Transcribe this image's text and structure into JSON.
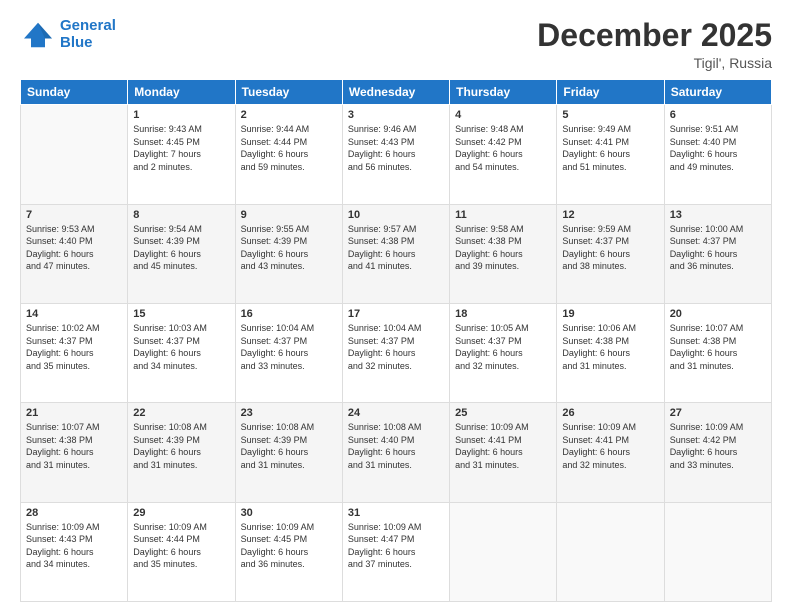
{
  "header": {
    "logo_line1": "General",
    "logo_line2": "Blue",
    "month": "December 2025",
    "location": "Tigil', Russia"
  },
  "weekdays": [
    "Sunday",
    "Monday",
    "Tuesday",
    "Wednesday",
    "Thursday",
    "Friday",
    "Saturday"
  ],
  "weeks": [
    [
      {
        "day": "",
        "info": ""
      },
      {
        "day": "1",
        "info": "Sunrise: 9:43 AM\nSunset: 4:45 PM\nDaylight: 7 hours\nand 2 minutes."
      },
      {
        "day": "2",
        "info": "Sunrise: 9:44 AM\nSunset: 4:44 PM\nDaylight: 6 hours\nand 59 minutes."
      },
      {
        "day": "3",
        "info": "Sunrise: 9:46 AM\nSunset: 4:43 PM\nDaylight: 6 hours\nand 56 minutes."
      },
      {
        "day": "4",
        "info": "Sunrise: 9:48 AM\nSunset: 4:42 PM\nDaylight: 6 hours\nand 54 minutes."
      },
      {
        "day": "5",
        "info": "Sunrise: 9:49 AM\nSunset: 4:41 PM\nDaylight: 6 hours\nand 51 minutes."
      },
      {
        "day": "6",
        "info": "Sunrise: 9:51 AM\nSunset: 4:40 PM\nDaylight: 6 hours\nand 49 minutes."
      }
    ],
    [
      {
        "day": "7",
        "info": "Sunrise: 9:53 AM\nSunset: 4:40 PM\nDaylight: 6 hours\nand 47 minutes."
      },
      {
        "day": "8",
        "info": "Sunrise: 9:54 AM\nSunset: 4:39 PM\nDaylight: 6 hours\nand 45 minutes."
      },
      {
        "day": "9",
        "info": "Sunrise: 9:55 AM\nSunset: 4:39 PM\nDaylight: 6 hours\nand 43 minutes."
      },
      {
        "day": "10",
        "info": "Sunrise: 9:57 AM\nSunset: 4:38 PM\nDaylight: 6 hours\nand 41 minutes."
      },
      {
        "day": "11",
        "info": "Sunrise: 9:58 AM\nSunset: 4:38 PM\nDaylight: 6 hours\nand 39 minutes."
      },
      {
        "day": "12",
        "info": "Sunrise: 9:59 AM\nSunset: 4:37 PM\nDaylight: 6 hours\nand 38 minutes."
      },
      {
        "day": "13",
        "info": "Sunrise: 10:00 AM\nSunset: 4:37 PM\nDaylight: 6 hours\nand 36 minutes."
      }
    ],
    [
      {
        "day": "14",
        "info": "Sunrise: 10:02 AM\nSunset: 4:37 PM\nDaylight: 6 hours\nand 35 minutes."
      },
      {
        "day": "15",
        "info": "Sunrise: 10:03 AM\nSunset: 4:37 PM\nDaylight: 6 hours\nand 34 minutes."
      },
      {
        "day": "16",
        "info": "Sunrise: 10:04 AM\nSunset: 4:37 PM\nDaylight: 6 hours\nand 33 minutes."
      },
      {
        "day": "17",
        "info": "Sunrise: 10:04 AM\nSunset: 4:37 PM\nDaylight: 6 hours\nand 32 minutes."
      },
      {
        "day": "18",
        "info": "Sunrise: 10:05 AM\nSunset: 4:37 PM\nDaylight: 6 hours\nand 32 minutes."
      },
      {
        "day": "19",
        "info": "Sunrise: 10:06 AM\nSunset: 4:38 PM\nDaylight: 6 hours\nand 31 minutes."
      },
      {
        "day": "20",
        "info": "Sunrise: 10:07 AM\nSunset: 4:38 PM\nDaylight: 6 hours\nand 31 minutes."
      }
    ],
    [
      {
        "day": "21",
        "info": "Sunrise: 10:07 AM\nSunset: 4:38 PM\nDaylight: 6 hours\nand 31 minutes."
      },
      {
        "day": "22",
        "info": "Sunrise: 10:08 AM\nSunset: 4:39 PM\nDaylight: 6 hours\nand 31 minutes."
      },
      {
        "day": "23",
        "info": "Sunrise: 10:08 AM\nSunset: 4:39 PM\nDaylight: 6 hours\nand 31 minutes."
      },
      {
        "day": "24",
        "info": "Sunrise: 10:08 AM\nSunset: 4:40 PM\nDaylight: 6 hours\nand 31 minutes."
      },
      {
        "day": "25",
        "info": "Sunrise: 10:09 AM\nSunset: 4:41 PM\nDaylight: 6 hours\nand 31 minutes."
      },
      {
        "day": "26",
        "info": "Sunrise: 10:09 AM\nSunset: 4:41 PM\nDaylight: 6 hours\nand 32 minutes."
      },
      {
        "day": "27",
        "info": "Sunrise: 10:09 AM\nSunset: 4:42 PM\nDaylight: 6 hours\nand 33 minutes."
      }
    ],
    [
      {
        "day": "28",
        "info": "Sunrise: 10:09 AM\nSunset: 4:43 PM\nDaylight: 6 hours\nand 34 minutes."
      },
      {
        "day": "29",
        "info": "Sunrise: 10:09 AM\nSunset: 4:44 PM\nDaylight: 6 hours\nand 35 minutes."
      },
      {
        "day": "30",
        "info": "Sunrise: 10:09 AM\nSunset: 4:45 PM\nDaylight: 6 hours\nand 36 minutes."
      },
      {
        "day": "31",
        "info": "Sunrise: 10:09 AM\nSunset: 4:47 PM\nDaylight: 6 hours\nand 37 minutes."
      },
      {
        "day": "",
        "info": ""
      },
      {
        "day": "",
        "info": ""
      },
      {
        "day": "",
        "info": ""
      }
    ]
  ]
}
